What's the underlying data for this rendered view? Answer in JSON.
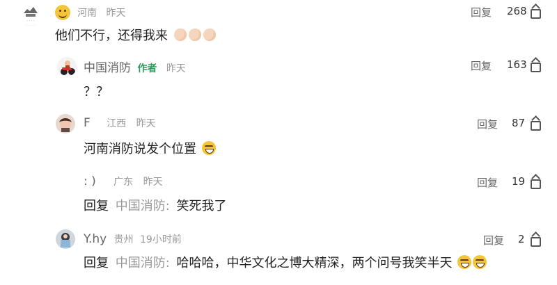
{
  "comments": [
    {
      "location": "河南",
      "time": "昨天",
      "content": "他们不行，还得我来",
      "reply_label": "回复",
      "likes": "268"
    },
    {
      "name": "中国消防",
      "author_tag": "作者",
      "time": "昨天",
      "content": "？？",
      "reply_label": "回复",
      "likes": "163"
    },
    {
      "name": "F",
      "location": "江西",
      "time": "昨天",
      "content": "河南消防说发个位置",
      "reply_label": "回复",
      "likes": "87"
    },
    {
      "name": ":  )",
      "location": "广东",
      "time": "昨天",
      "content_prefix": "回复",
      "reply_target": "中国消防:",
      "content": "笑死我了",
      "reply_label": "回复",
      "likes": "19"
    },
    {
      "name": "Y.hy",
      "location": "贵州",
      "time": "19小时前",
      "content_prefix": "回复",
      "reply_target": "中国消防:",
      "content": "哈哈哈，中华文化之博大精深，两个问号我笑半天",
      "reply_label": "回复",
      "likes": "2"
    }
  ]
}
